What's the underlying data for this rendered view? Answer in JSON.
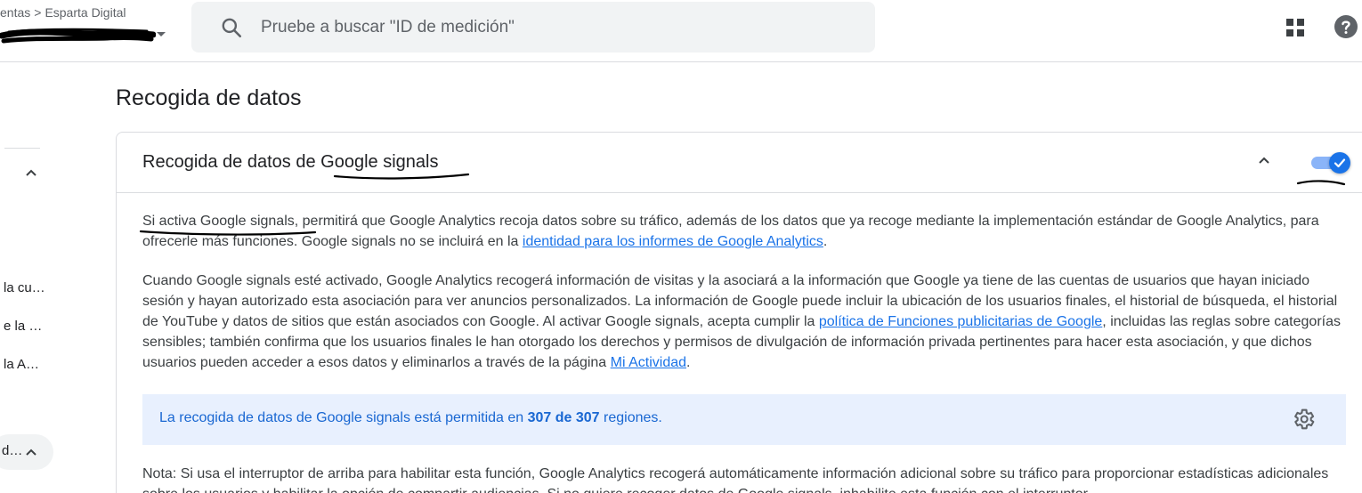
{
  "header": {
    "breadcrumb": [
      "entas",
      "Esparta Digital"
    ],
    "search_placeholder": "Pruebe a buscar \"ID de medición\""
  },
  "sidebar": {
    "items": [
      "la cu…",
      "e la …",
      "la A…"
    ],
    "pill_label": "d…"
  },
  "page": {
    "title": "Recogida de datos"
  },
  "card": {
    "title": "Recogida de datos de Google signals",
    "toggle_on": true,
    "p1": {
      "text_before": "Si activa Google signals, permitirá que Google Analytics recoja datos sobre su tráfico, además de los datos que ya recoge mediante la implementación estándar de Google Analytics, para ofrecerle más funciones. Google signals no se incluirá en la ",
      "link": "identidad para los informes de Google Analytics",
      "text_after": "."
    },
    "p2": {
      "text_before": "Cuando Google signals esté activado, Google Analytics recogerá información de visitas y la asociará a la información que Google ya tiene de las cuentas de usuarios que hayan iniciado sesión y hayan autorizado esta asociación para ver anuncios personalizados. La información de Google puede incluir la ubicación de los usuarios finales, el historial de búsqueda, el historial de YouTube y datos de sitios que están asociados con Google. Al activar Google signals, acepta cumplir la ",
      "link1": "política de Funciones publicitarias de Google",
      "text_middle": ", incluidas las reglas sobre categorías sensibles; también confirma que los usuarios finales le han otorgado los derechos y permisos de divulgación de información privada pertinentes para hacer esta asociación, y que dichos usuarios pueden acceder a esos datos y eliminarlos a través de la página ",
      "link2": "Mi Actividad",
      "text_after": "."
    },
    "banner": {
      "text_before": "La recogida de datos de Google signals está permitida en ",
      "count": "307 de 307",
      "text_after": " regiones."
    },
    "note": "Nota: Si usa el interruptor de arriba para habilitar esta función, Google Analytics recogerá automáticamente información adicional sobre su tráfico para proporcionar estadísticas adicionales sobre los usuarios y habilitar la opción de compartir audiencias. Si no quiere recoger datos de Google signals, inhabilite esta función con el interruptor."
  },
  "colors": {
    "accent": "#1a73e8",
    "banner_bg": "#e8f0fe"
  }
}
